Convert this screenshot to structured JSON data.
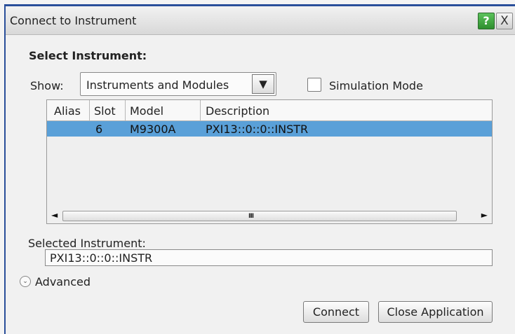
{
  "window": {
    "title": "Connect to Instrument",
    "help_label": "?",
    "close_label": "X"
  },
  "select_instrument": {
    "heading": "Select Instrument:",
    "show_label": "Show:",
    "show_value": "Instruments and Modules",
    "dropdown_arrow": "▼",
    "simulation_label": "Simulation Mode",
    "simulation_checked": false
  },
  "table": {
    "columns": [
      "Alias",
      "Slot",
      "Model",
      "Description"
    ],
    "rows": [
      {
        "alias": "",
        "slot": "6",
        "model": "M9300A",
        "description": "PXI13::0::0::INSTR",
        "selected": true
      }
    ],
    "scroll_left": "◄",
    "scroll_right": "►",
    "scroll_grip": "III"
  },
  "selected_instrument": {
    "label": "Selected Instrument:",
    "value": "PXI13::0::0::INSTR"
  },
  "advanced": {
    "label": "Advanced",
    "icon": "chevron-down-icon"
  },
  "buttons": {
    "connect": "Connect",
    "close_application": "Close Application"
  },
  "colors": {
    "selection": "#5aa0d8",
    "help_button": "#3aa53a",
    "window_border": "#2a4f9a"
  }
}
